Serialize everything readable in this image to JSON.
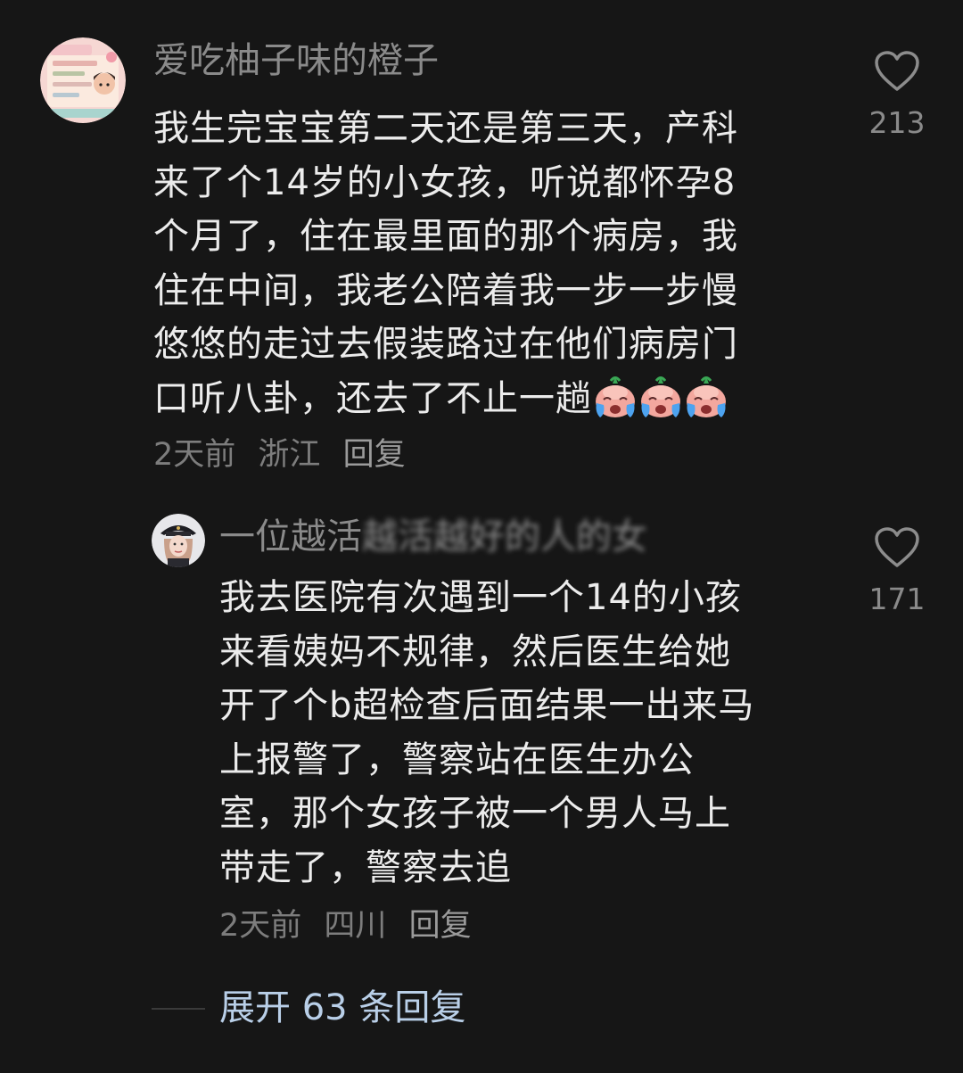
{
  "comments": [
    {
      "username": "爱吃柚子味的橙子",
      "avatar_icon": "cartoon-sticker-avatar",
      "lines": [
        "我生完宝宝第二天还是第三天，产科",
        "来了个14岁的小女孩，听说都怀孕8",
        "个月了，住在最里面的那个病房，我",
        "住在中间，我老公陪着我一步一步慢",
        "悠悠的走过去假装路过在他们病房门",
        "口听八卦，还去了不止一趟"
      ],
      "emoji": [
        "crying-face-emoji",
        "crying-face-emoji",
        "crying-face-emoji"
      ],
      "time": "2天前",
      "location": "浙江",
      "reply_label": "回复",
      "like_icon": "heart-outline-icon",
      "like_count": "213"
    },
    {
      "username_visible": "一位越活",
      "username_obscured": "越活越好的人的女",
      "avatar_icon": "girl-photo-avatar",
      "lines": [
        "我去医院有次遇到一个14的小孩",
        "来看姨妈不规律，然后医生给她",
        "开了个b超检查后面结果一出来马",
        "上报警了，警察站在医生办公",
        "室，那个女孩子被一个男人马上",
        "带走了，警察去追"
      ],
      "time": "2天前",
      "location": "四川",
      "reply_label": "回复",
      "like_icon": "heart-outline-icon",
      "like_count": "171"
    }
  ],
  "expand_replies": "展开 63 条回复",
  "colors": {
    "background": "#161616",
    "text": "#ececec",
    "secondary": "#8a8a8a",
    "link": "#b9cfe8"
  }
}
